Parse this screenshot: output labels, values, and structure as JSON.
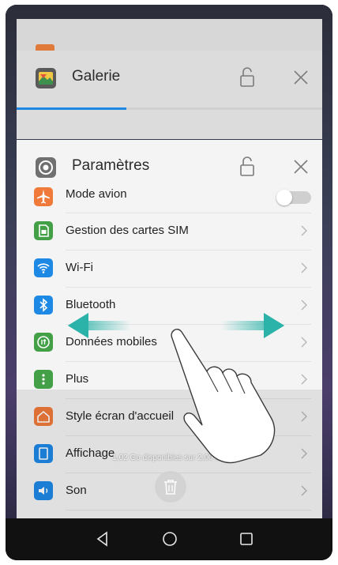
{
  "recents": {
    "galerie": {
      "title": "Galerie",
      "progress_fraction": 0.36
    },
    "parametres": {
      "title": "Paramètres"
    }
  },
  "settings": {
    "items": [
      {
        "label": "Mode avion",
        "icon": "airplane-icon",
        "color": "#f07a3a",
        "control": "toggle",
        "toggle_on": false
      },
      {
        "label": "Gestion des cartes SIM",
        "icon": "sim-card-icon",
        "color": "#43a047",
        "control": "chevron"
      },
      {
        "label": "Wi-Fi",
        "icon": "wifi-icon",
        "color": "#1e88e5",
        "control": "chevron"
      },
      {
        "label": "Bluetooth",
        "icon": "bluetooth-icon",
        "color": "#1e88e5",
        "control": "chevron"
      },
      {
        "label": "Données mobiles",
        "icon": "mobile-data-icon",
        "color": "#43a047",
        "control": "chevron"
      },
      {
        "label": "Plus",
        "icon": "more-icon",
        "color": "#43a047",
        "control": "chevron"
      },
      {
        "label": "Style écran d'accueil",
        "icon": "home-style-icon",
        "color": "#f07a3a",
        "control": "chevron"
      },
      {
        "label": "Affichage",
        "icon": "display-icon",
        "color": "#1e88e5",
        "control": "chevron"
      },
      {
        "label": "Son",
        "icon": "sound-icon",
        "color": "#1e88e5",
        "control": "chevron"
      }
    ]
  },
  "memory_text": "1,02 Go disponibles sur 2,00 Go",
  "colors": {
    "accent": "#1e88e5",
    "swipe_arrow": "#2bb3a9"
  },
  "gesture": {
    "type": "swipe-left-right",
    "icon": "hand-pointer-icon"
  },
  "navbar": {
    "back": "back-icon",
    "home": "home-icon",
    "recents": "recents-icon"
  }
}
